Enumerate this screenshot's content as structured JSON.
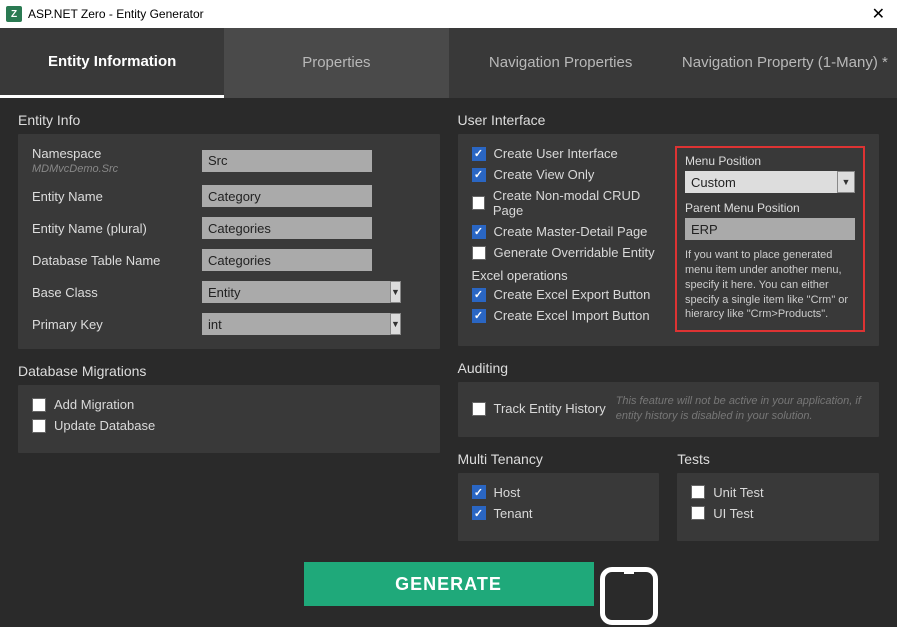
{
  "window": {
    "title": "ASP.NET Zero - Entity Generator"
  },
  "tabs": {
    "t0": "Entity Information",
    "t1": "Properties",
    "t2": "Navigation Properties",
    "t3": "Navigation Property (1-Many) *"
  },
  "entityInfo": {
    "heading": "Entity Info",
    "namespace_label": "Namespace",
    "namespace_hint": "MDMvcDemo.Src",
    "namespace_value": "Src",
    "entityName_label": "Entity Name",
    "entityName_value": "Category",
    "entityNamePlural_label": "Entity Name (plural)",
    "entityNamePlural_value": "Categories",
    "dbTable_label": "Database Table Name",
    "dbTable_value": "Categories",
    "baseClass_label": "Base Class",
    "baseClass_value": "Entity",
    "primaryKey_label": "Primary Key",
    "primaryKey_value": "int"
  },
  "dbMigration": {
    "heading": "Database Migrations",
    "add": "Add Migration",
    "update": "Update Database"
  },
  "ui": {
    "heading": "User Interface",
    "c1": "Create User Interface",
    "c2": "Create View Only",
    "c3": "Create Non-modal CRUD Page",
    "c4": "Create Master-Detail Page",
    "c5": "Generate Overridable Entity",
    "excel_heading": "Excel operations",
    "c6": "Create Excel Export Button",
    "c7": "Create Excel Import Button",
    "menuPos_label": "Menu Position",
    "menuPos_value": "Custom",
    "parentMenu_label": "Parent Menu Position",
    "parentMenu_value": "ERP",
    "help": "If you want to place generated menu item under another menu, specify it here. You can either specify a single item like \"Crm\" or hierarcy like \"Crm>Products\"."
  },
  "auditing": {
    "heading": "Auditing",
    "track": "Track Entity History",
    "help": "This feature will not be active in your application, if entity history is disabled in your solution."
  },
  "multiTenancy": {
    "heading": "Multi Tenancy",
    "host": "Host",
    "tenant": "Tenant"
  },
  "tests": {
    "heading": "Tests",
    "unit": "Unit Test",
    "uitest": "UI Test"
  },
  "generate": {
    "label": "GENERATE"
  }
}
